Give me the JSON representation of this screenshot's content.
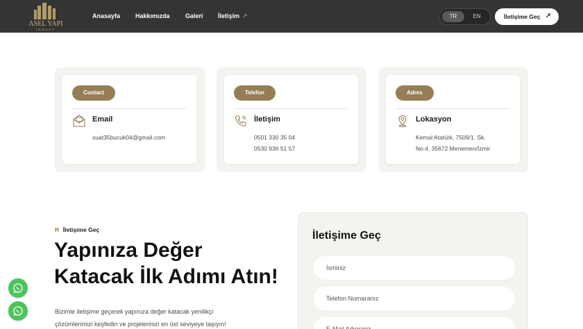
{
  "nav": {
    "logo_text": "ASEL YAPI",
    "logo_subtext": "İNŞAAT",
    "links": [
      "Anasayfa",
      "Hakkımızda",
      "Galeri",
      "İletişim"
    ],
    "lang_active": "TR",
    "lang_other": "EN",
    "cta_label": "İletişime Geç"
  },
  "cards": [
    {
      "pill": "Contact",
      "title": "Email",
      "lines": [
        "suat35bucuk04@gmail.com"
      ],
      "icon": "envelope-icon"
    },
    {
      "pill": "Telefon",
      "title": "İletişim",
      "lines": [
        "0501 330 35 04",
        "0530 936 51 57"
      ],
      "icon": "phone-icon"
    },
    {
      "pill": "Adres",
      "title": "Lokasyon",
      "lines": [
        "Kemal Atatürk, 7509/1. Sk.",
        "No:4, 35672 Menemen/İzmir"
      ],
      "icon": "location-pin-icon"
    }
  ],
  "section": {
    "eyebrow": "İletişime Geç",
    "headline_1": "Yapınıza Değer",
    "headline_2": "Katacak İlk Adımı Atın!",
    "desc_1": "Bizimle iletişime geçerek yapınıza değer katacak yenilikçi",
    "desc_2": "çözümlerimizi keşfedin ve projelerinizi en üst seviyeye taşıyın!"
  },
  "form": {
    "title": "İletişime Geç",
    "name_placeholder": "İsminiz",
    "phone_placeholder": "Telefon Numaranız",
    "email_placeholder": "E-Mail Adresiniz"
  },
  "colors": {
    "accent": "#957e55",
    "nav_bg": "#343434",
    "whatsapp": "#4bc45b"
  }
}
